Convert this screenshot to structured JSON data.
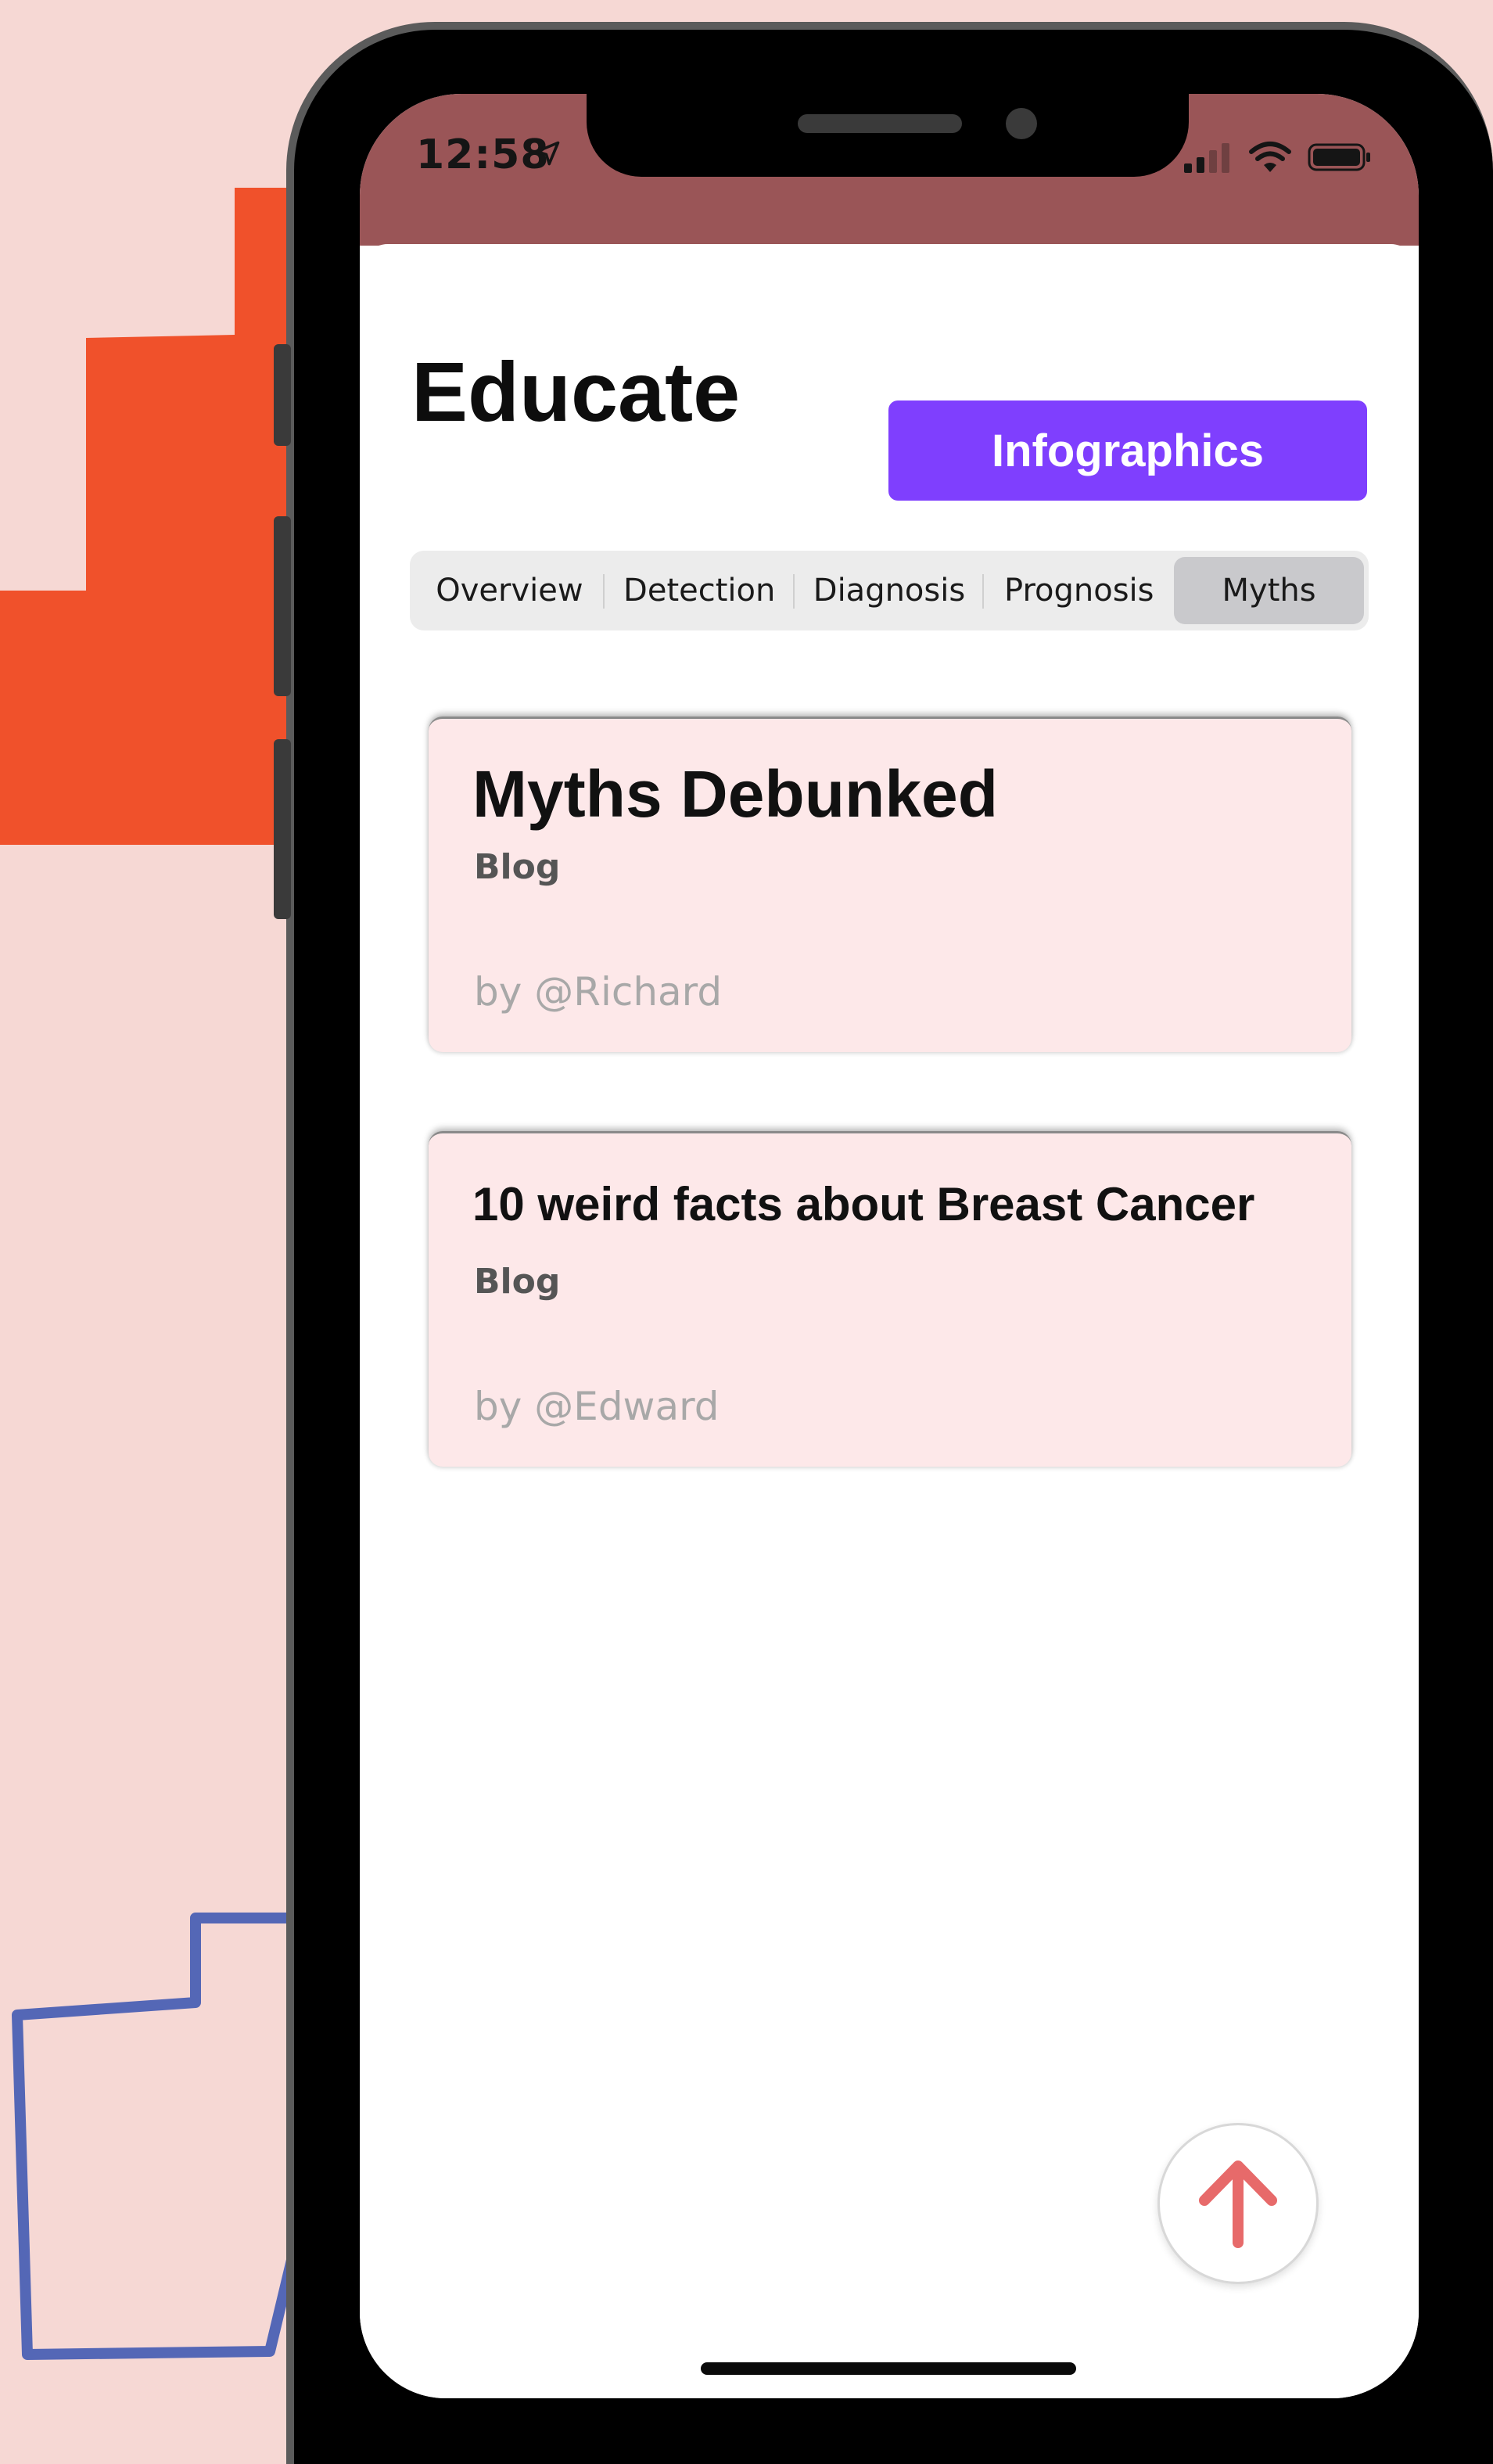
{
  "status_bar": {
    "time": "12:58"
  },
  "header": {
    "title": "Educate",
    "infographics_button": "Infographics"
  },
  "tabs": [
    {
      "label": "Overview",
      "active": false
    },
    {
      "label": "Detection",
      "active": false
    },
    {
      "label": "Diagnosis",
      "active": false
    },
    {
      "label": "Prognosis",
      "active": false
    },
    {
      "label": "Myths",
      "active": true
    }
  ],
  "cards": [
    {
      "title": "Myths Debunked",
      "type": "Blog",
      "author": "by @Richard"
    },
    {
      "title": "10 weird facts about Breast Cancer",
      "type": "Blog",
      "author": "by @Edward"
    }
  ],
  "icons": {
    "location": "location-arrow-icon",
    "signal": "cellular-signal-icon",
    "wifi": "wifi-icon",
    "battery": "battery-icon",
    "scroll_top": "arrow-up-icon"
  },
  "colors": {
    "accent": "#7f3ffe",
    "status_bar": "#9a5557",
    "card_background": "#fde8e9",
    "fab_arrow": "#e76a6a",
    "deco_orange": "#f0512b",
    "deco_blue": "#5467b6",
    "background": "#f6d8d4"
  }
}
